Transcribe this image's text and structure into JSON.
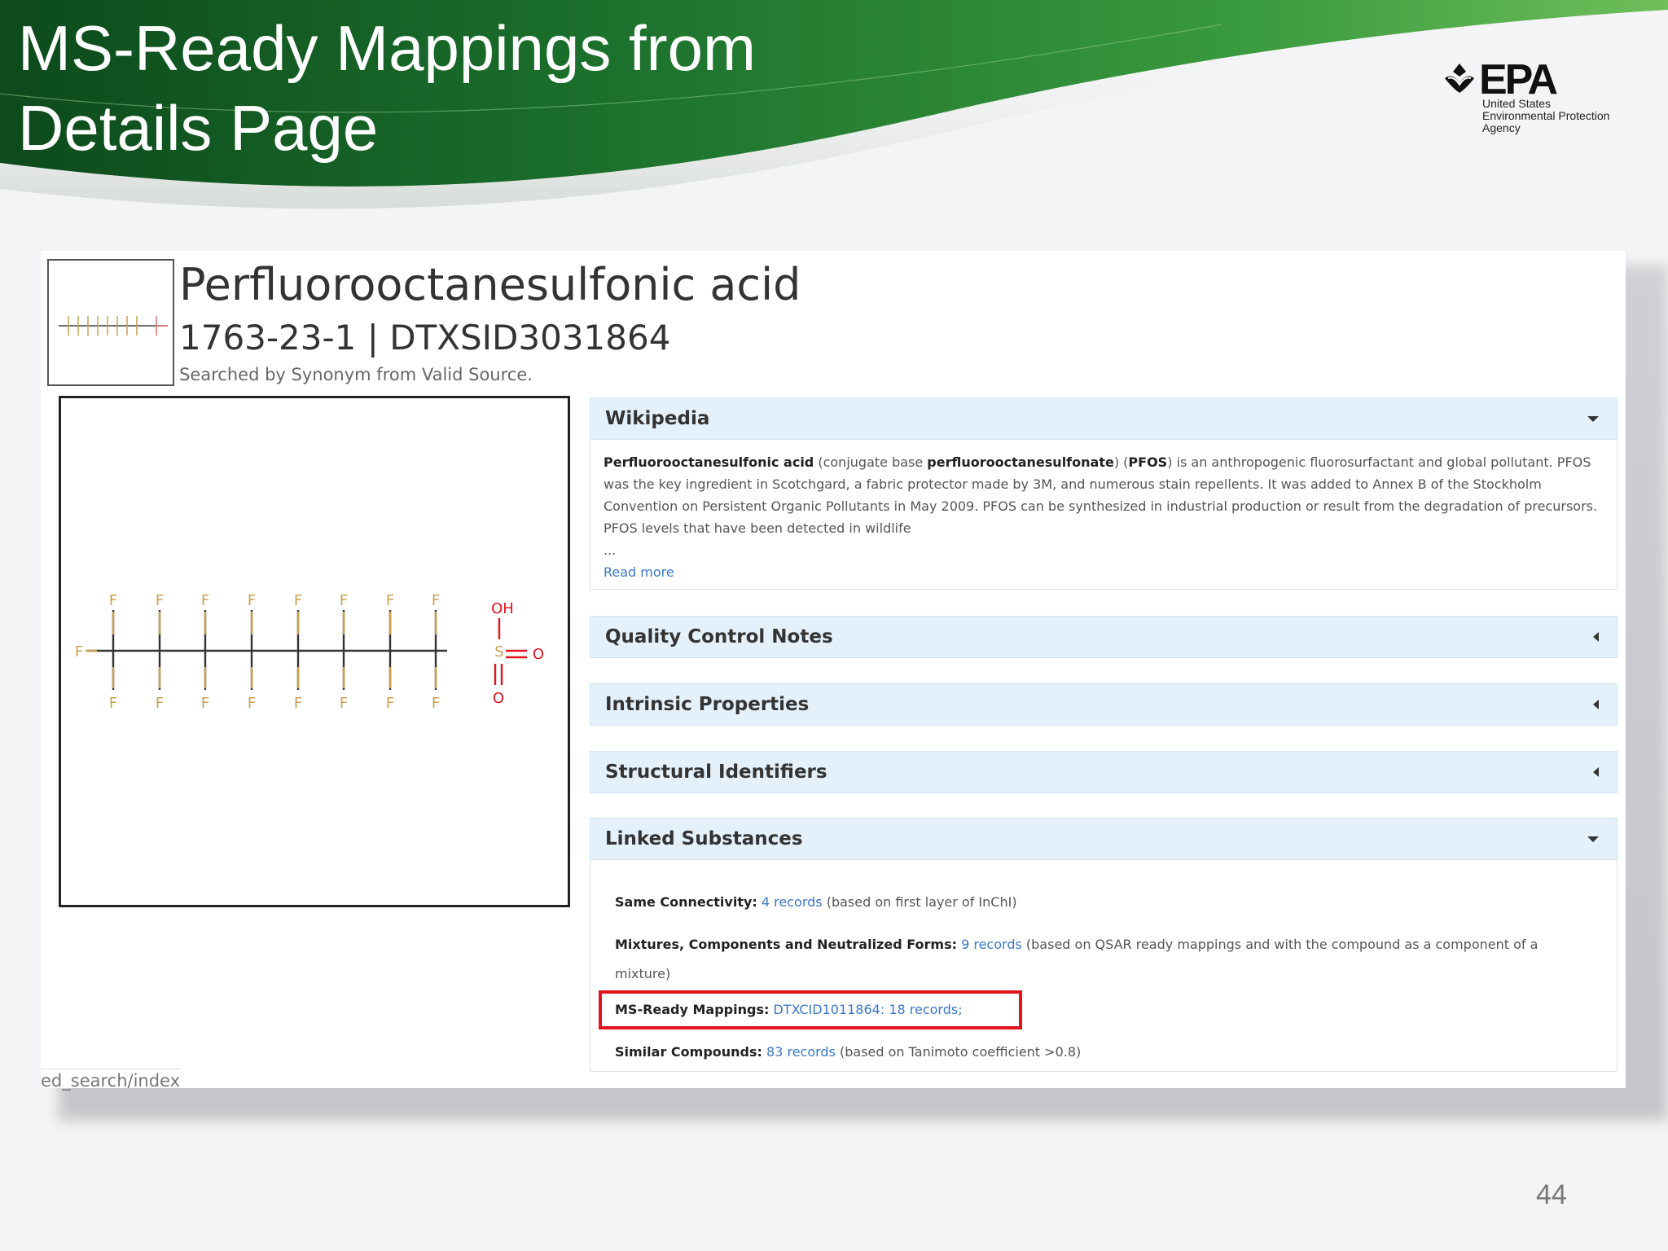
{
  "slide": {
    "title_line1": "MS-Ready Mappings from",
    "title_line2": "Details Page",
    "page_number": "44"
  },
  "logo": {
    "word": "EPA",
    "sub1": "United States",
    "sub2": "Environmental Protection",
    "sub3": "Agency"
  },
  "chemical": {
    "name": "Perfluorooctanesulfonic acid",
    "ids": "1763-23-1 | DTXSID3031864",
    "search_note": "Searched by Synonym from Valid Source."
  },
  "structure": {
    "atom_f": "F",
    "atom_oh": "OH",
    "atom_s": "S",
    "atom_o": "O"
  },
  "wikipedia": {
    "title": "Wikipedia",
    "term_bold": "Perfluorooctanesulfonic acid",
    "text_a": " (conjugate base ",
    "term_bold2": "perfluorooctanesulfonate",
    "text_b": ") (",
    "term_bold3": "PFOS",
    "text_c": ") is an anthropogenic fluorosurfactant and global pollutant. PFOS was the key ingredient in Scotchgard, a fabric protector made by 3M, and numerous stain repellents. It was added to Annex B of the Stockholm Convention on Persistent Organic Pollutants in May 2009. PFOS can be synthesized in industrial production or result from the degradation of precursors. PFOS levels that have been detected in wildlife",
    "ellipsis": "...",
    "read_more": "Read more"
  },
  "sections": {
    "qc": "Quality Control Notes",
    "intrinsic": "Intrinsic Properties",
    "structural": "Structural Identifiers",
    "linked": "Linked Substances"
  },
  "linked": {
    "same_label": "Same Connectivity:",
    "same_link": "4 records",
    "same_note": " (based on first layer of InChI)",
    "mix_label": "Mixtures, Components and Neutralized Forms:",
    "mix_link": "9 records",
    "mix_note": " (based on QSAR ready mappings and with the compound as a component of a mixture)",
    "ms_label": "MS-Ready Mappings:",
    "ms_link": "DTXCID1011864: 18 records;",
    "sim_label": "Similar Compounds:",
    "sim_link": "83 records",
    "sim_note": " (based on Tanimoto coefficient >0.8)"
  },
  "browser": {
    "url_fragment": "ed_search/index"
  },
  "colors": {
    "banner_green": "#1e7a2e",
    "accordion_header": "#e4f1fb",
    "link_blue": "#3a78c8",
    "highlight_red": "#e2131d",
    "oxygen_red": "#e2131d"
  }
}
